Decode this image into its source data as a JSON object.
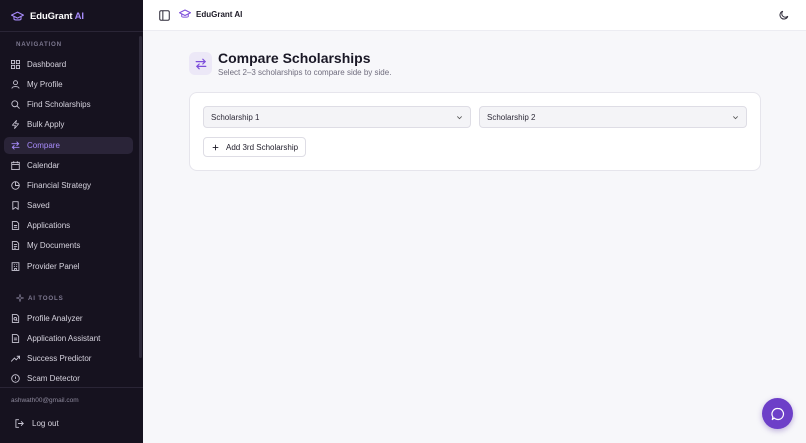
{
  "brand": {
    "name": "EduGrant",
    "suffix": "AI",
    "top_name": "EduGrant AI"
  },
  "sidebar": {
    "nav_heading": "NAVIGATION",
    "nav_items": [
      {
        "label": "Dashboard",
        "icon": "grid-icon"
      },
      {
        "label": "My Profile",
        "icon": "user-icon"
      },
      {
        "label": "Find Scholarships",
        "icon": "search-icon"
      },
      {
        "label": "Bulk Apply",
        "icon": "bolt-icon"
      },
      {
        "label": "Compare",
        "icon": "swap-icon",
        "active": true
      },
      {
        "label": "Calendar",
        "icon": "calendar-icon"
      },
      {
        "label": "Financial Strategy",
        "icon": "pie-icon"
      },
      {
        "label": "Saved",
        "icon": "bookmark-icon"
      },
      {
        "label": "Applications",
        "icon": "file-icon"
      },
      {
        "label": "My Documents",
        "icon": "document-icon"
      },
      {
        "label": "Provider Panel",
        "icon": "building-icon"
      }
    ],
    "ai_heading": "AI TOOLS",
    "ai_items": [
      {
        "label": "Profile Analyzer",
        "icon": "file-search-icon"
      },
      {
        "label": "Application Assistant",
        "icon": "file-pen-icon"
      },
      {
        "label": "Success Predictor",
        "icon": "trend-icon"
      },
      {
        "label": "Scam Detector",
        "icon": "shield-icon"
      }
    ],
    "user_email": "ashwath00@gmail.com",
    "logout_label": "Log out"
  },
  "page": {
    "title": "Compare Scholarships",
    "subtitle": "Select 2–3 scholarships to compare side by side."
  },
  "compare": {
    "select_1": "Scholarship 1",
    "select_2": "Scholarship 2",
    "add_label": "Add 3rd Scholarship"
  },
  "colors": {
    "accent": "#7c4ddb",
    "sidebar_bg": "#16121f",
    "fab": "#6d3fc8"
  }
}
